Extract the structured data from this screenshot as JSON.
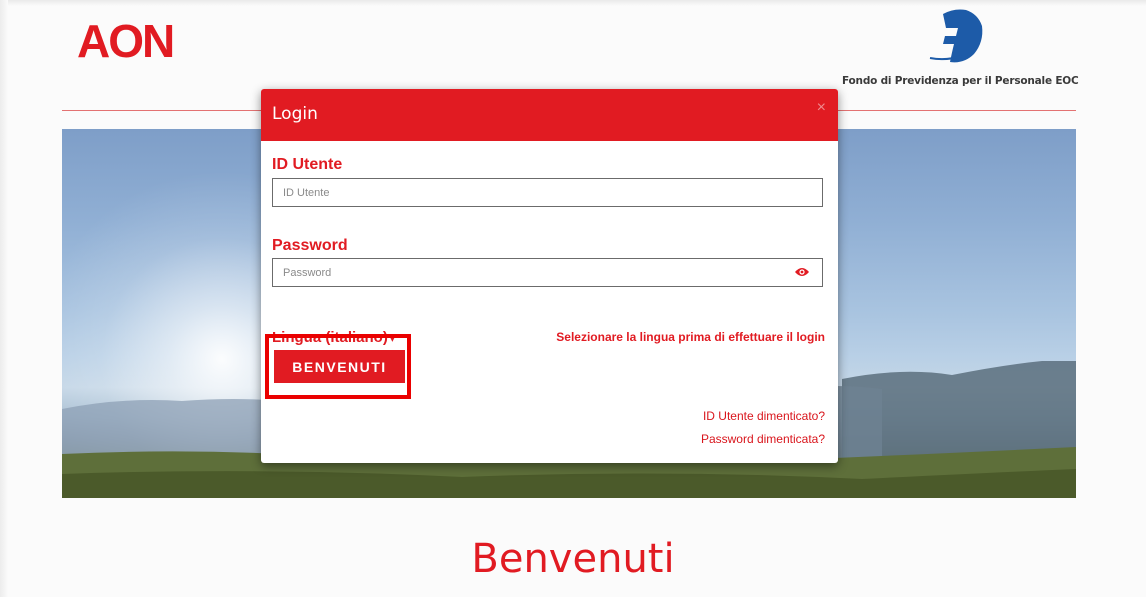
{
  "header": {
    "brand_logo": "AON",
    "fund_name": "Fondo di Previdenza per il Personale EOC"
  },
  "modal": {
    "title": "Login",
    "close_symbol": "×",
    "user_id_label": "ID Utente",
    "user_id_value": "",
    "user_id_placeholder": "ID Utente",
    "password_label": "Password",
    "password_value": "",
    "password_placeholder": "Password",
    "language_label": "Lingua (italiano)",
    "language_caret": "▾",
    "language_hint": "Selezionare la lingua prima di effettuare il login",
    "login_button_label": "BENVENUTI",
    "forgot_user_id": "ID Utente dimenticato?",
    "forgot_password": "Password dimenticata?"
  },
  "main": {
    "welcome_heading": "Benvenuti"
  },
  "icons": {
    "close": "close-icon",
    "password_toggle": "eye-icon",
    "fund": "fund-logo-icon"
  },
  "colors": {
    "brand_red": "#e11b22",
    "fund_blue": "#1d5ba8",
    "highlight": "#ea0000"
  }
}
